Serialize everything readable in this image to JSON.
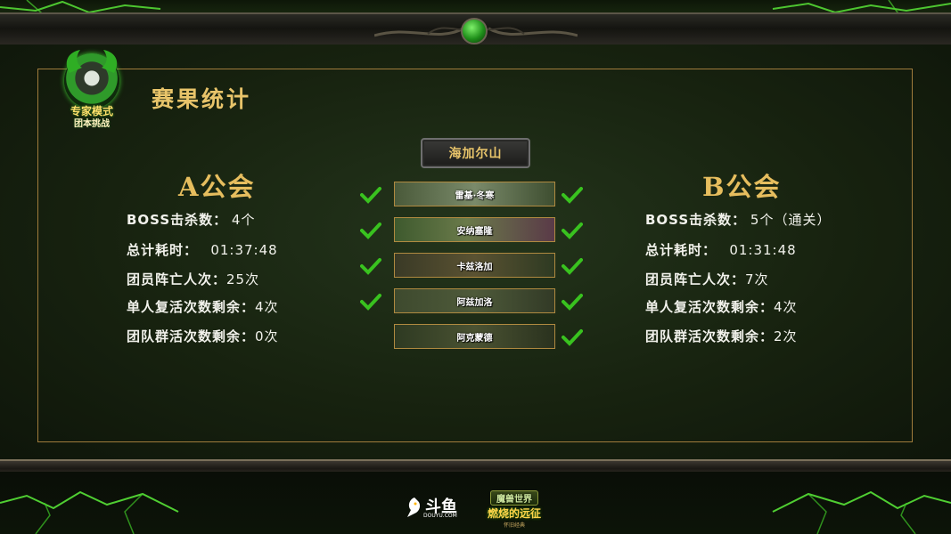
{
  "page_title": "赛果统计",
  "logo": {
    "line1": "专家模式",
    "line2": "团本挑战"
  },
  "map": {
    "label": "海加尔山"
  },
  "guild_a": {
    "name": "A公会",
    "stats": [
      {
        "label": "BOSS击杀数：",
        "value": "4个"
      },
      {
        "label": "总计耗时：",
        "value": "01:37:48"
      },
      {
        "label": "团员阵亡人次：",
        "value": "25次"
      },
      {
        "label": "单人复活次数剩余：",
        "value": "4次"
      },
      {
        "label": "团队群活次数剩余：",
        "value": "0次"
      }
    ]
  },
  "guild_b": {
    "name": "B公会",
    "stats": [
      {
        "label": "BOSS击杀数：",
        "value": "5个（通关）"
      },
      {
        "label": "总计耗时：",
        "value": "01:31:48"
      },
      {
        "label": "团员阵亡人次：",
        "value": "7次"
      },
      {
        "label": "单人复活次数剩余：",
        "value": "4次"
      },
      {
        "label": "团队群活次数剩余：",
        "value": "2次"
      }
    ]
  },
  "bosses": [
    {
      "name": "雷基·冬寒",
      "a_killed": true,
      "b_killed": true
    },
    {
      "name": "安纳塞隆",
      "a_killed": true,
      "b_killed": true
    },
    {
      "name": "卡兹洛加",
      "a_killed": true,
      "b_killed": true
    },
    {
      "name": "阿兹加洛",
      "a_killed": true,
      "b_killed": true
    },
    {
      "name": "阿克蒙德",
      "a_killed": false,
      "b_killed": true
    }
  ],
  "sponsors": {
    "douyu": {
      "brand": "斗鱼",
      "url_text": "DOUYU.COM"
    },
    "wow": {
      "line1": "魔兽世界",
      "line2": "燃烧的远征",
      "line3": "怀旧经典"
    }
  },
  "colors": {
    "accent_gold": "#e6bd5e",
    "check_green": "#39c21f",
    "frame_gold": "#a07c3c"
  }
}
